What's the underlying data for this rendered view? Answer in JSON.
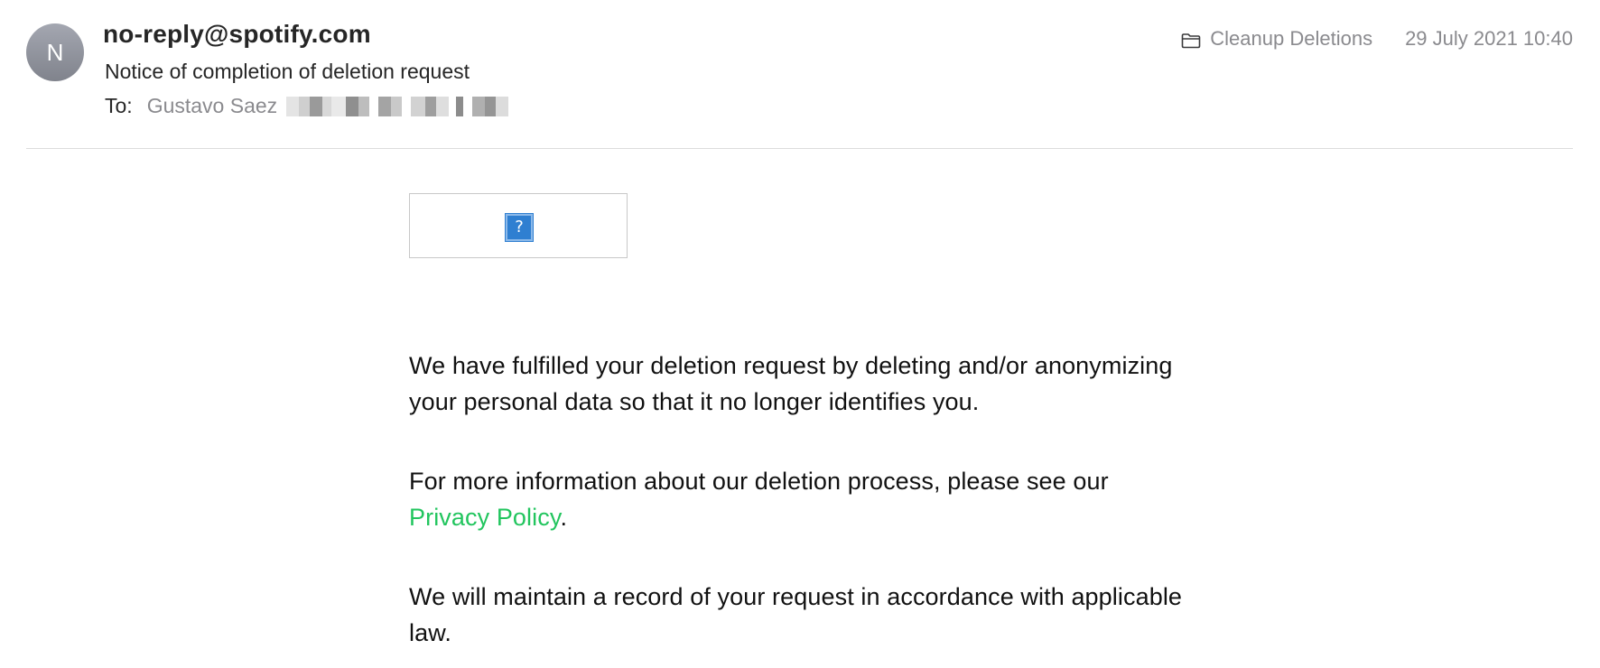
{
  "header": {
    "avatar_initial": "N",
    "sender": "no-reply@spotify.com",
    "subject": "Notice of completion of deletion request",
    "to_label": "To:",
    "to_name": "Gustavo Saez",
    "mailbox_icon": "folder-icon",
    "mailbox": "Cleanup Deletions",
    "date": "29 July 2021 10:40"
  },
  "message": {
    "image_placeholder_icon": "broken-image-question-icon",
    "image_placeholder_glyph": "?",
    "paragraph1": "We have fulfilled your deletion request by deleting and/or anonymizing your personal data so that it no longer identifies you.",
    "paragraph2_before": "For more information about our deletion process, please see our ",
    "paragraph2_link": "Privacy Policy",
    "paragraph2_after": ".",
    "paragraph3": "We will maintain a record of your request in accordance with applicable law."
  },
  "colors": {
    "link": "#22c55e",
    "avatar": "#8e9199",
    "muted_text": "#8a8a8e"
  }
}
